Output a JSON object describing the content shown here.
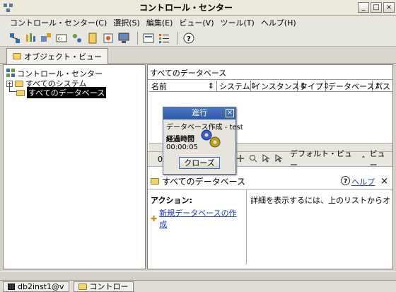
{
  "window": {
    "title": "コントロール・センター"
  },
  "menu": [
    "コントロール・センター(C)",
    "選択(S)",
    "編集(E)",
    "ビュー(V)",
    "ツール(T)",
    "ヘルプ(H)"
  ],
  "tab": {
    "label": "オブジェクト・ビュー"
  },
  "tree": {
    "root": "コントロール・センター",
    "systems": "すべてのシステム",
    "databases": "すべてのデータベース"
  },
  "list": {
    "title": "すべてのデータベース",
    "columns": [
      "名前",
      "システム",
      "インスタンス",
      "タイプ",
      "データベース",
      "パス"
    ],
    "default_view": "デフォルト・ビュー",
    "view_short": "ビュー"
  },
  "dialog": {
    "title": "進行",
    "task": "データベース作成 - test",
    "elapsed_label": "経過時間",
    "elapsed": "00:00:05",
    "close_label": "クローズ"
  },
  "details": {
    "title": "すべてのデータベース",
    "help_label": "ヘルプ",
    "actions_label": "アクション:",
    "new_db_link": "新規データベースの作成",
    "hint": "詳細を表示するには、上のリストからオブジェクトを選"
  },
  "taskbar": {
    "item1": "db2inst1@v",
    "item2": "コントロー"
  },
  "colors": {
    "accent": "#2f5aa8",
    "selection": "#000000"
  }
}
